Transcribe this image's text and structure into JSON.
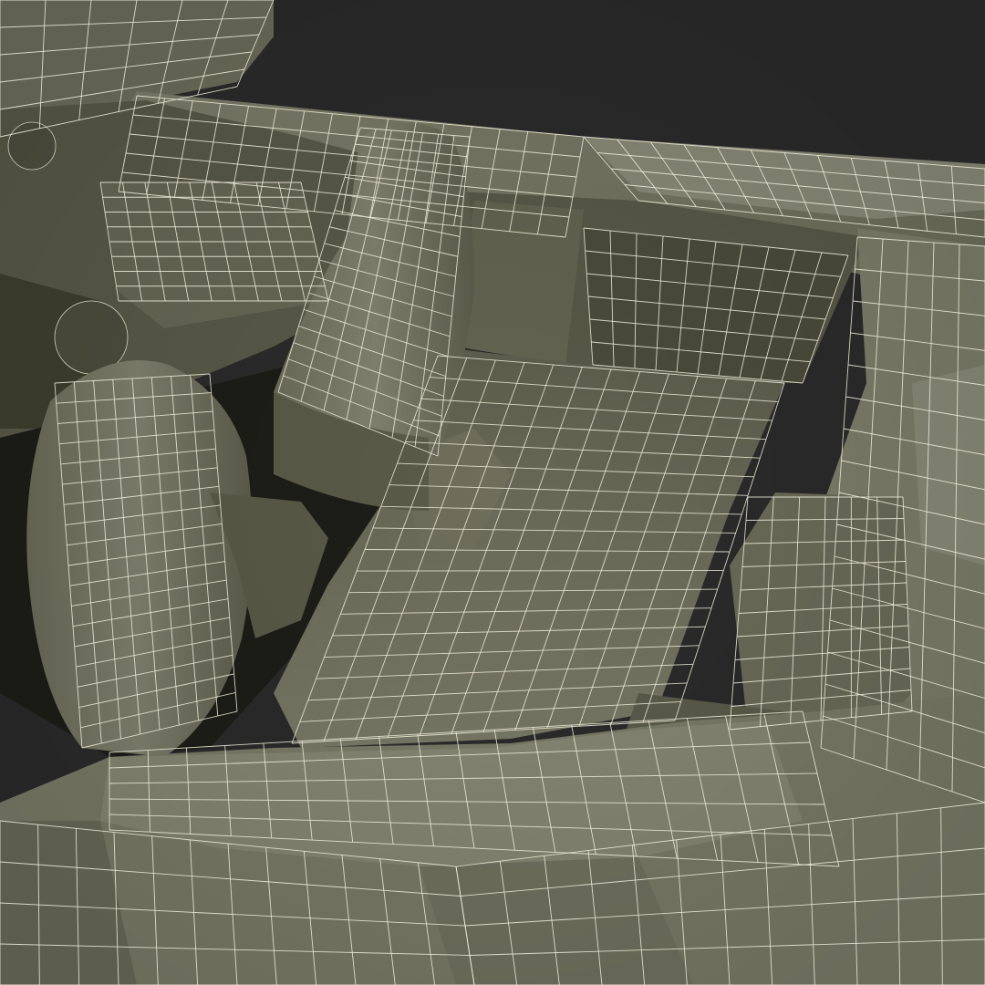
{
  "image": {
    "subject": "wireframe-render",
    "colors": {
      "background": "#2b2b2b",
      "surface_light": "#868676",
      "surface_mid": "#72725f",
      "surface_dark": "#535344",
      "cavity": "#1d1e17",
      "wire": "#f1eedc"
    }
  }
}
